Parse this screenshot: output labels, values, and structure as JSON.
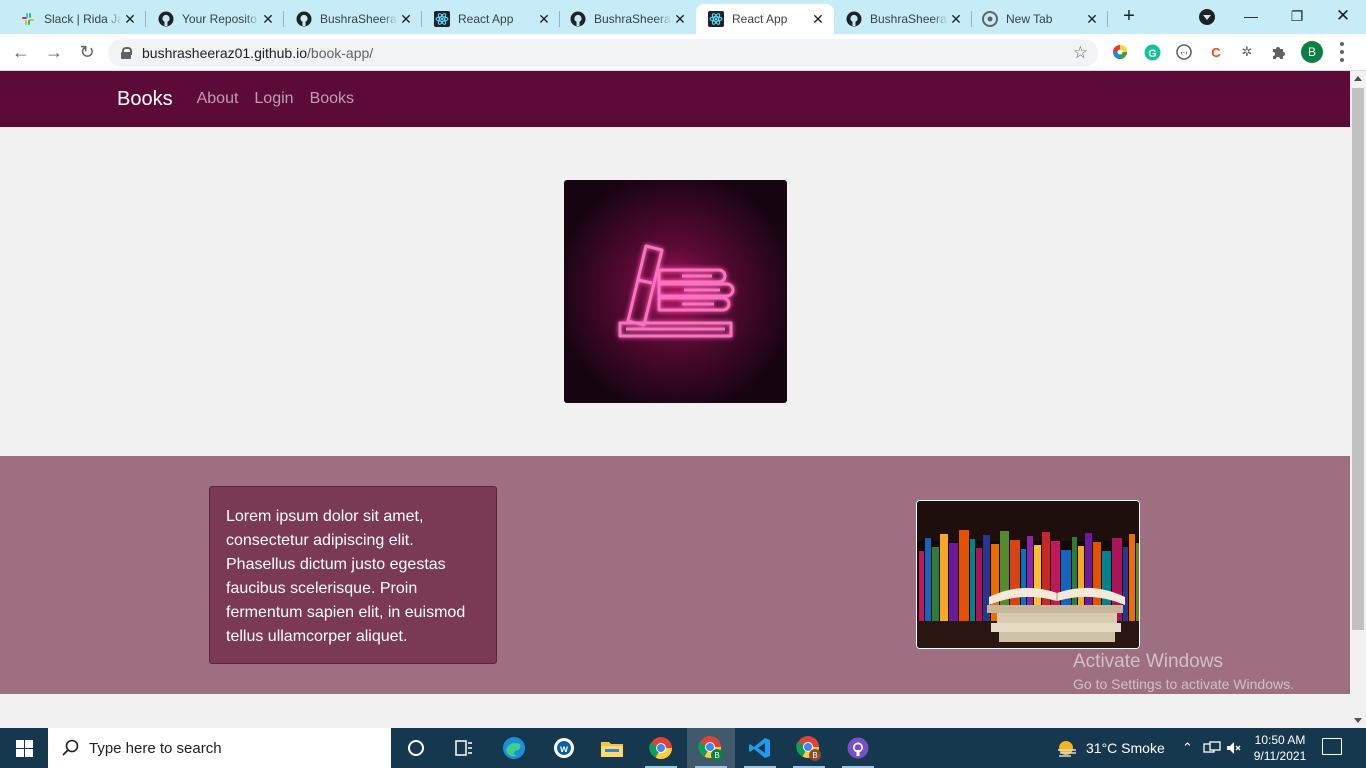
{
  "browser": {
    "tabs": [
      {
        "title": "Slack | Rida Ja",
        "icon": "slack-icon",
        "active": false
      },
      {
        "title": "Your Reposito",
        "icon": "github-icon",
        "active": false
      },
      {
        "title": "BushraSheera",
        "icon": "github-icon",
        "active": false
      },
      {
        "title": "React App",
        "icon": "react-icon",
        "active": false
      },
      {
        "title": "BushraSheera",
        "icon": "github-icon",
        "active": false
      },
      {
        "title": "React App",
        "icon": "react-icon",
        "active": true
      },
      {
        "title": "BushraSheera",
        "icon": "github-icon",
        "active": false
      },
      {
        "title": "New Tab",
        "icon": "chrome-icon",
        "active": false
      }
    ],
    "url_host": "bushrasheeraz01.github.io",
    "url_path": "/book-app/",
    "profile_initial": "B",
    "accent": "#c5ecf7"
  },
  "site": {
    "brand": "Books",
    "nav": [
      "About",
      "Login",
      "Books"
    ],
    "nav_color": "#5c0a37",
    "band_color": "#9e6f81",
    "card_text": "Lorem ipsum dolor sit amet, consectetur adipiscing elit. Phasellus dictum justo egestas faucibus scelerisque. Proin fermentum sapien elit, in euismod tellus ullamcorper aliquet."
  },
  "watermark": {
    "line1": "Activate Windows",
    "line2": "Go to Settings to activate Windows."
  },
  "taskbar": {
    "search_placeholder": "Type here to search",
    "weather": "31°C  Smoke",
    "time": "10:50 AM",
    "date": "9/11/2021"
  }
}
